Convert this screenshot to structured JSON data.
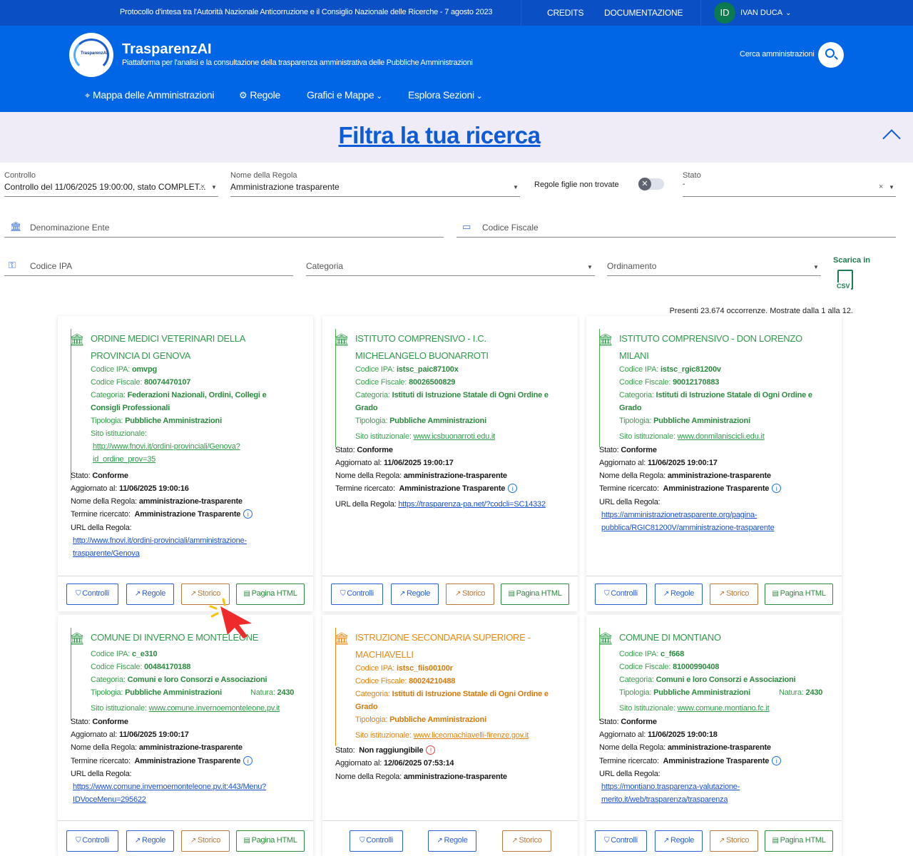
{
  "topbar": {
    "protocol": "Protocollo d'intesa tra l'Autorità Nazionale Anticorruzione e il Consiglio Nazionale delle Ricerche - 7 agosto 2023",
    "credits": "CREDITS",
    "docs": "DOCUMENTAZIONE",
    "avatar": "ID",
    "user": "IVAN DUCA"
  },
  "header": {
    "logo_text": "TrasparenzAI",
    "brand": "TrasparenzAI",
    "tagline": "Piattaforma per l'analisi e la consultazione della trasparenza amministrativa delle Pubbliche Amministrazioni",
    "search_label": "Cerca amministrazioni",
    "nav": [
      "Mappa delle Amministrazioni",
      "Regole",
      "Grafici e Mappe",
      "Esplora Sezioni"
    ]
  },
  "filter": {
    "title": "Filtra la tua ricerca",
    "controllo_label": "Controllo",
    "controllo_value": "Controllo del 11/06/2025 19:00:00, stato COMPLET...",
    "regola_label": "Nome della Regola",
    "regola_value": "Amministrazione trasparente",
    "figlie_label": "Regole figlie non trovate",
    "stato_label": "Stato",
    "stato_value": "-",
    "denominazione_ph": "Denominazione Ente",
    "cf_ph": "Codice Fiscale",
    "ipa_ph": "Codice IPA",
    "categoria_ph": "Categoria",
    "ordinamento_ph": "Ordinamento",
    "csv_label": "Scarica in",
    "csv_icon": "CSV",
    "count": "Presenti 23.674 occorrenze. Mostrate dalla 1 alla 12."
  },
  "labels": {
    "ipa": "Codice IPA:",
    "cf": "Codice Fiscale:",
    "cat": "Categoria:",
    "tip": "Tipologia:",
    "sito": "Sito istituzionale:",
    "natura": "Natura:",
    "stato": "Stato:",
    "agg": "Aggiornato al:",
    "regola": "Nome della Regola:",
    "termine": "Termine ricercato:",
    "url": "URL della Regola:"
  },
  "buttons": {
    "controlli": "Controlli",
    "regole": "Regole",
    "storico": "Storico",
    "html": "Pagina HTML"
  },
  "cards": [
    {
      "title1": "ORDINE MEDICI VETERINARI DELLA",
      "title2": "PROVINCIA DI GENOVA",
      "ipa": "omvpg",
      "cf": "80074470107",
      "cat1": "Federazioni Nazionali, Ordini, Collegi e",
      "cat2": "Consigli Professionali",
      "tip": "Pubbliche Amministrazioni",
      "sito1": "http://www.fnovi.it/ordini-provinciali/Genova?",
      "sito2": "id_ordine_prov=35",
      "stato": "Conforme",
      "agg": "11/06/2025 19:00:16",
      "regola": "amministrazione-trasparente",
      "termine": "Amministrazione Trasparente",
      "url1": "http://www.fnovi.it/ordini-provinciali/amministrazione-",
      "url2": "trasparente/Genova"
    },
    {
      "title1": "ISTITUTO COMPRENSIVO - I.C.",
      "title2": "MICHELANGELO BUONARROTI",
      "ipa": "istsc_paic87100x",
      "cf": "80026500829",
      "cat1": "Istituti di Istruzione Statale di Ogni Ordine e",
      "cat2": "Grado",
      "tip": "Pubbliche Amministrazioni",
      "sito1": "www.icsbuonarroti.edu.it",
      "stato": "Conforme",
      "agg": "11/06/2025 19:00:17",
      "regola": "amministrazione-trasparente",
      "termine": "Amministrazione Trasparente",
      "url1": "https://trasparenza-pa.net/?codcli=SC14332"
    },
    {
      "title1": "ISTITUTO COMPRENSIVO - DON LORENZO",
      "title2": "MILANI",
      "ipa": "istsc_rgic81200v",
      "cf": "90012170883",
      "cat1": "Istituti di Istruzione Statale di Ogni Ordine e",
      "cat2": "Grado",
      "tip": "Pubbliche Amministrazioni",
      "sito1": "www.donmilaniscicli.edu.it",
      "stato": "Conforme",
      "agg": "11/06/2025 19:00:17",
      "regola": "amministrazione-trasparente",
      "termine": "Amministrazione Trasparente",
      "url1": "https://amministrazionetrasparente.org/pagina-",
      "url2": "pubblica/RGIC81200V/amministrazione-trasparente"
    },
    {
      "title1": "COMUNE DI INVERNO E MONTELEONE",
      "ipa": "c_e310",
      "cf": "00484170188",
      "cat1": "Comuni e loro Consorzi e Associazioni",
      "tip": "Pubbliche Amministrazioni",
      "natura": "2430",
      "sito1": "www.comune.invernoemonteleone.pv.it",
      "stato": "Conforme",
      "agg": "11/06/2025 19:00:17",
      "regola": "amministrazione-trasparente",
      "termine": "Amministrazione Trasparente",
      "url1": "https://www.comune.invernoemonteleone.pv.it:443/Menu?",
      "url2": "IDVoceMenu=295622"
    },
    {
      "title1": "ISTRUZIONE SECONDARIA SUPERIORE -",
      "title2": "MACHIAVELLI",
      "ipa": "istsc_fiis00100r",
      "cf": "80024210488",
      "cat1": "Istituti di Istruzione Statale di Ogni Ordine e",
      "cat2": "Grado",
      "tip": "Pubbliche Amministrazioni",
      "sito1": "www.liceomachiavelli-firenze.gov.it",
      "stato": "Non raggiungibile",
      "agg": "12/06/2025 07:53:14",
      "regola": "amministrazione-trasparente"
    },
    {
      "title1": "COMUNE DI MONTIANO",
      "ipa": "c_f668",
      "cf": "81000990408",
      "cat1": "Comuni e loro Consorzi e Associazioni",
      "tip": "Pubbliche Amministrazioni",
      "natura": "2430",
      "sito1": "www.comune.montiano.fc.it",
      "stato": "Conforme",
      "agg": "11/06/2025 19:00:18",
      "regola": "amministrazione-trasparente",
      "termine": "Amministrazione Trasparente",
      "url1": "https://montiano.trasparenza-valutazione-",
      "url2": "merito.it/web/trasparenza/trasparenza"
    }
  ],
  "colors": {
    "topbar": "#0a4fc4",
    "header": "#0066e6",
    "banner": "#efebf7",
    "green": "#2f9a4a",
    "orange": "#e88a12",
    "link": "#1a4fd0"
  }
}
